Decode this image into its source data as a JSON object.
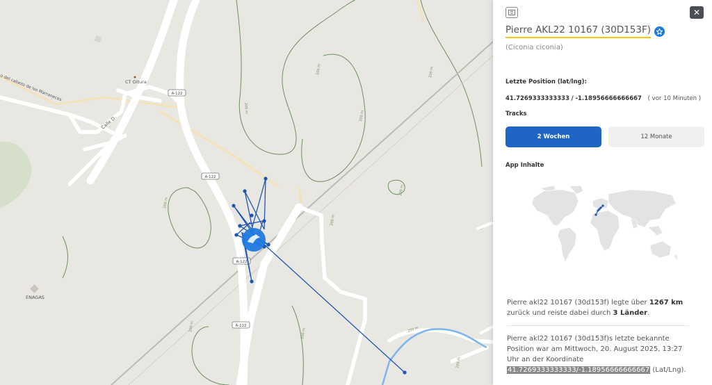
{
  "map": {
    "place_labels": [
      {
        "id": "ct-oitura",
        "text": "CT Oitura"
      },
      {
        "id": "enagas",
        "text": "ENAGAS"
      },
      {
        "id": "calle-d",
        "text": "Calle D"
      },
      {
        "id": "cabezo",
        "text": "o del cabezo de los Marraneces"
      }
    ],
    "road_labels": [
      "A-122",
      "A-122",
      "A-122",
      "A-122"
    ],
    "contour_label": "200 m"
  },
  "panel": {
    "bird_name": "Pierre AKL22 10167 (30D153F)",
    "species": "(Ciconia ciconia)",
    "last_position_label": "Letzte Position (lat/lng):",
    "lat": "41.7269333333333",
    "separator": "/",
    "lng": "-1.18956666666667",
    "time_ago": "( vor 10 Minuten )",
    "tracks_label": "Tracks",
    "tab_weeks": "2 Wochen",
    "tab_months": "12 Monate",
    "app_content_label": "App Inhalte",
    "summary1": {
      "pre": "Pierre akl22 10167 (30d153f) legte über",
      "km": "1267 km",
      "mid": "zurück und reiste dabei durch",
      "countries": "3 Länder",
      "end": "."
    },
    "summary2": {
      "text": "Pierre akl22 10167 (30d153f)s letzte bekannte Position war am Mittwoch, 20. August 2025, 13:27 Uhr an der Koordinate",
      "coord": "41.7269333333333/-1.18956666666667",
      "suffix": "(Lat/Lng)."
    }
  },
  "colors": {
    "track": "#1e55b3",
    "position_marker": "#1f7ae0",
    "active_tab": "#1f65c4",
    "highlight_underline": "#f2c80f",
    "river": "#7db4ee",
    "contour": "#6e8f5e"
  }
}
